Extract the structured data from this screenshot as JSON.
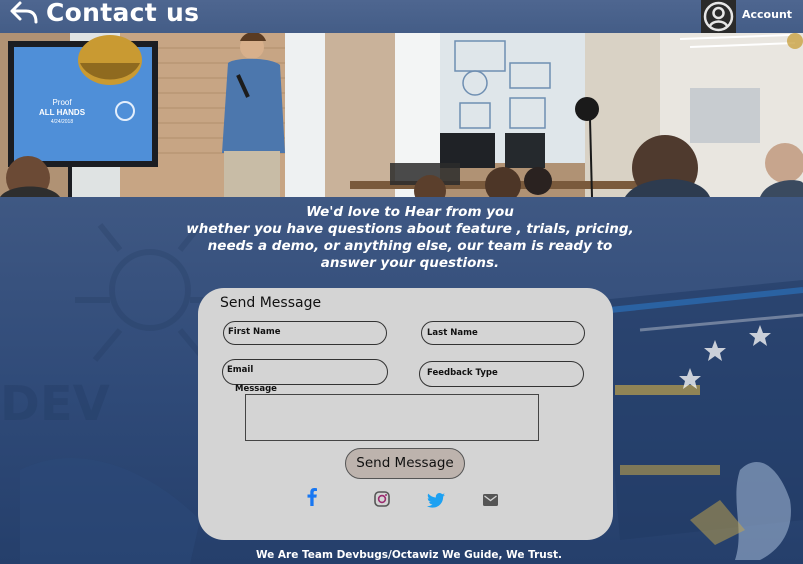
{
  "header": {
    "title": "Contact us",
    "account_label": "Account"
  },
  "intro": {
    "lines": [
      "We'd love to Hear from you",
      "whether you have questions about feature , trials, pricing,",
      "needs a demo, or anything else, our team is ready to",
      "answer your questions."
    ]
  },
  "form": {
    "title": "Send Message",
    "first_name_label": "First Name",
    "last_name_label": "Last Name",
    "email_label": "Email",
    "feedback_type_label": "Feedback Type",
    "message_label": "Message",
    "send_button": "Send Message"
  },
  "social": {
    "icons": [
      "facebook-icon",
      "instagram-icon",
      "twitter-icon",
      "mail-icon"
    ],
    "colors": {
      "facebook": "#1877f2",
      "twitter": "#1da1f2"
    }
  },
  "hero": {
    "screen_text": [
      "Proof",
      "ALL HANDS",
      "4/24/2018"
    ]
  },
  "footer": {
    "text": "We Are Team Devbugs/Octawiz We Guide, We Trust."
  }
}
